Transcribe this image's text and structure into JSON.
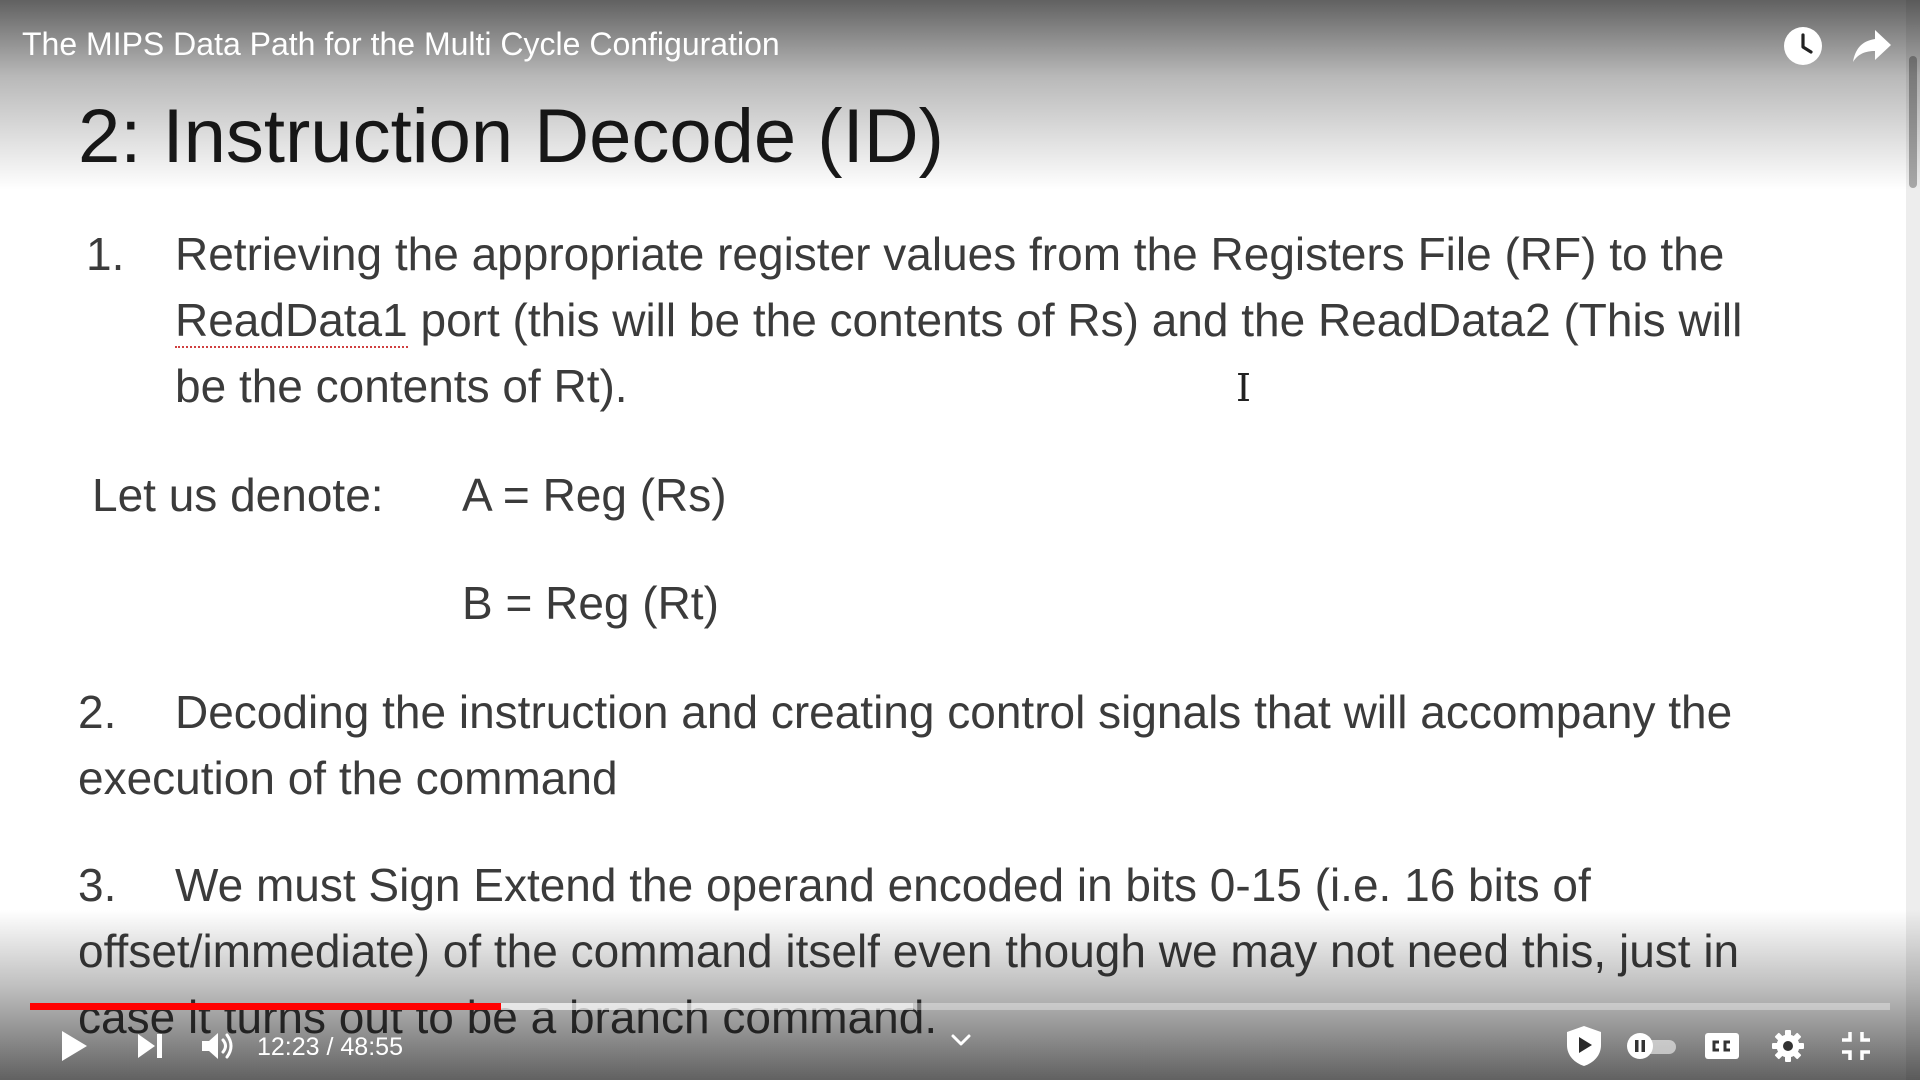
{
  "video": {
    "title": "The MIPS Data Path for the Multi Cycle Configuration"
  },
  "slide": {
    "title": "2: Instruction Decode (ID)",
    "item1": {
      "number": "1.",
      "line1": "Retrieving the appropriate register values from the Registers File (RF) to the",
      "line2_word": "ReadData1",
      "line2_rest": " port (this will be the contents of Rs) and the ReadData2 (This will",
      "line3": "be the contents of Rt)."
    },
    "denote": {
      "label": "Let us denote:",
      "eq_a": "A = Reg (Rs)",
      "eq_b": "B = Reg (Rt)"
    },
    "item2": {
      "number": "2.",
      "line1": "Decoding the instruction and creating control signals that will accompany the",
      "line2": "execution of the command"
    },
    "item3": {
      "number": "3.",
      "line1": "We must Sign Extend the operand encoded in bits 0-15 (i.e. 16 bits of",
      "line2": "offset/immediate) of the command itself even though we may not need this, just in",
      "line3": "case it turns out to be a branch command."
    }
  },
  "player": {
    "time_current": "12:23",
    "time_separator": " / ",
    "time_duration": "48:55",
    "progress_fraction": 0.2532,
    "buffered_fraction": 0.2215,
    "colors": {
      "progress_played": "#ff0000",
      "chrome_text": "#ffffff"
    },
    "icons": {
      "watch_later": "clock-icon",
      "share": "share-icon",
      "play": "play-icon",
      "next": "next-icon",
      "volume": "volume-icon",
      "chapters": "chevron-down-icon",
      "shield": "shield-icon",
      "autoplay": "autoplay-toggle",
      "captions": "cc-icon",
      "settings": "gear-icon",
      "exit_fullscreen": "exit-fullscreen-icon"
    }
  }
}
